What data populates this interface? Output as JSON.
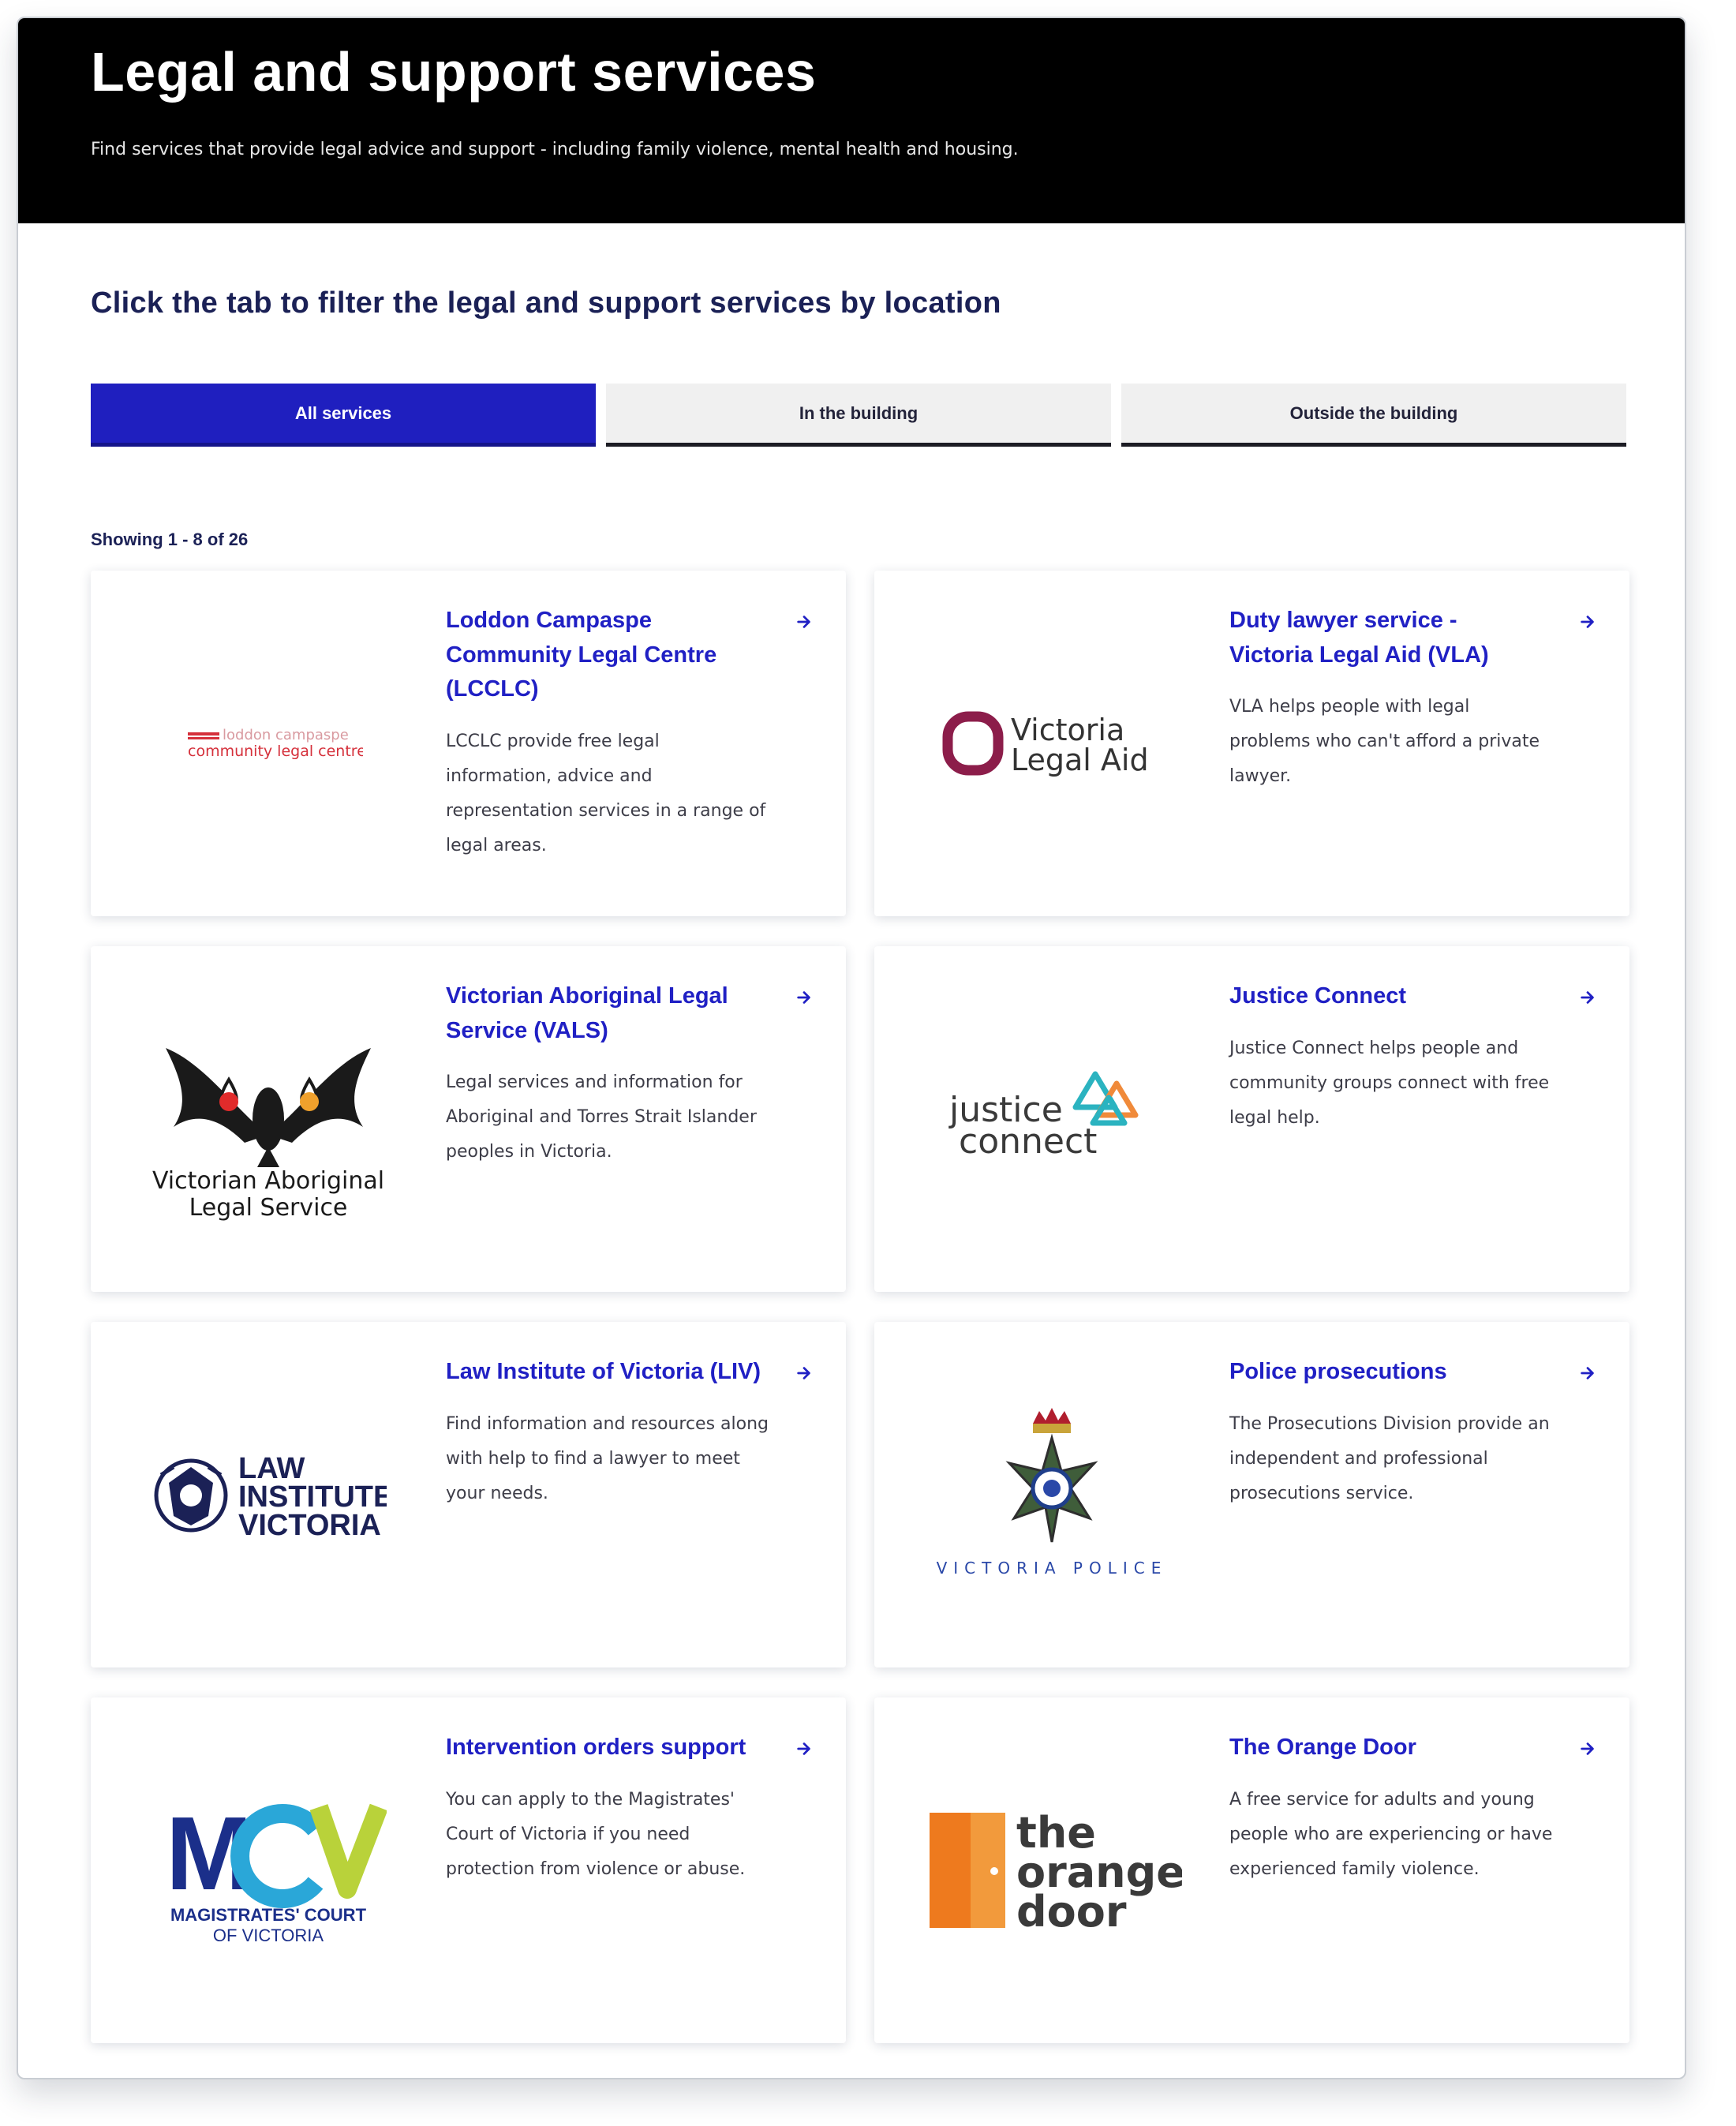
{
  "hero": {
    "title": "Legal and support services",
    "subtitle": "Find services that provide legal advice and support - including family violence, mental health and housing."
  },
  "filter": {
    "heading": "Click the tab to filter the legal and support services by location",
    "tabs": [
      {
        "label": "All services",
        "active": true
      },
      {
        "label": "In the building",
        "active": false
      },
      {
        "label": "Outside the building",
        "active": false
      }
    ]
  },
  "results": {
    "showing": "Showing 1 - 8 of 26"
  },
  "services": [
    {
      "title": "Loddon Campaspe Community Legal Centre (LCCLC)",
      "description": "LCCLC provide free legal information, advice and representation services in a range of legal areas.",
      "logo_text_1": "loddon campaspe",
      "logo_text_2": "community legal centre"
    },
    {
      "title": "Duty lawyer service - Victoria Legal Aid (VLA)",
      "description": "VLA helps people with legal problems who can't afford a private lawyer.",
      "logo_text_1": "Victoria",
      "logo_text_2": "Legal Aid"
    },
    {
      "title": "Victorian Aboriginal Legal Service (VALS)",
      "description": "Legal services and information for Aboriginal and Torres Strait Islander peoples in Victoria.",
      "logo_text_1": "Victorian Aboriginal",
      "logo_text_2": "Legal Service"
    },
    {
      "title": "Justice Connect",
      "description": "Justice Connect helps people and community groups connect with free legal help.",
      "logo_text_1": "justice",
      "logo_text_2": "connect"
    },
    {
      "title": "Law Institute of Victoria (LIV)",
      "description": "Find information and resources along with help to find a lawyer to meet your needs.",
      "logo_text_1": "LAW",
      "logo_text_2": "INSTITUTE",
      "logo_text_3": "VICTORIA"
    },
    {
      "title": "Police prosecutions",
      "description": "The Prosecutions Division provide an independent and professional prosecutions service.",
      "logo_text_1": "VICTORIA POLICE"
    },
    {
      "title": "Intervention orders support",
      "description": "You can apply to the Magistrates' Court of Victoria if you need protection from violence or abuse.",
      "logo_text_1": "MCV",
      "logo_text_2": "MAGISTRATES' COURT",
      "logo_text_3": "OF VICTORIA"
    },
    {
      "title": "The Orange Door",
      "description": "A free service for adults and young people who are experiencing or have experienced family violence.",
      "logo_text_1": "the",
      "logo_text_2": "orange",
      "logo_text_3": "door"
    }
  ],
  "colors": {
    "accent": "#1f1fbf",
    "link": "#2020c4",
    "heading": "#1b2156",
    "hero_bg": "#000000"
  },
  "icons": {
    "card_link": "arrow-right-icon"
  }
}
